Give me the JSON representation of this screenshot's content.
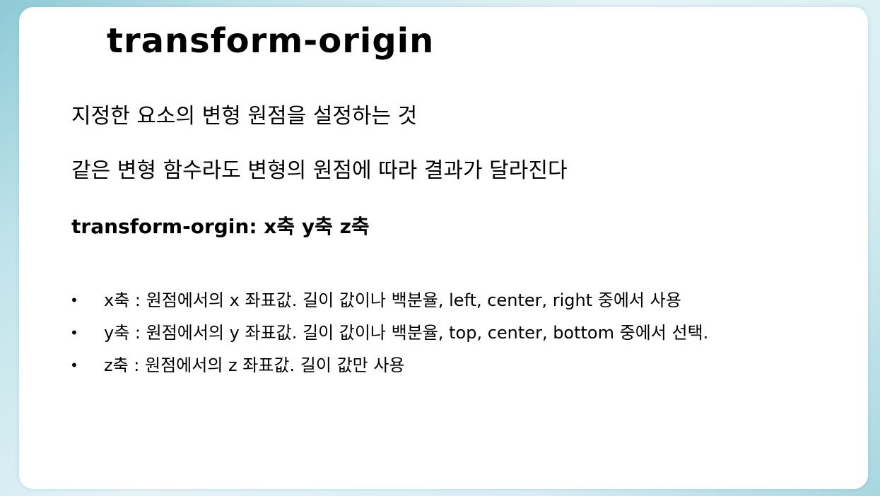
{
  "slide": {
    "title": "transform-origin",
    "description": [
      "지정한 요소의 변형 원점을 설정하는 것",
      "같은 변형 함수라도 변형의 원점에 따라 결과가 달라진다"
    ],
    "syntax": "transform-orgin: x축 y축 z축",
    "bullet_symbol": "•",
    "bullets": [
      "x축 : 원점에서의 x 좌표값. 길이 값이나 백분율, left, center, right 중에서 사용",
      "y축 : 원점에서의 y 좌표값. 길이 값이나 백분율, top, center, bottom 중에서 선택.",
      "z축 : 원점에서의 z 좌표값. 길이 값만 사용"
    ]
  },
  "colors": {
    "background": "#bfe3ea",
    "card": "#ffffff",
    "text": "#000000"
  }
}
